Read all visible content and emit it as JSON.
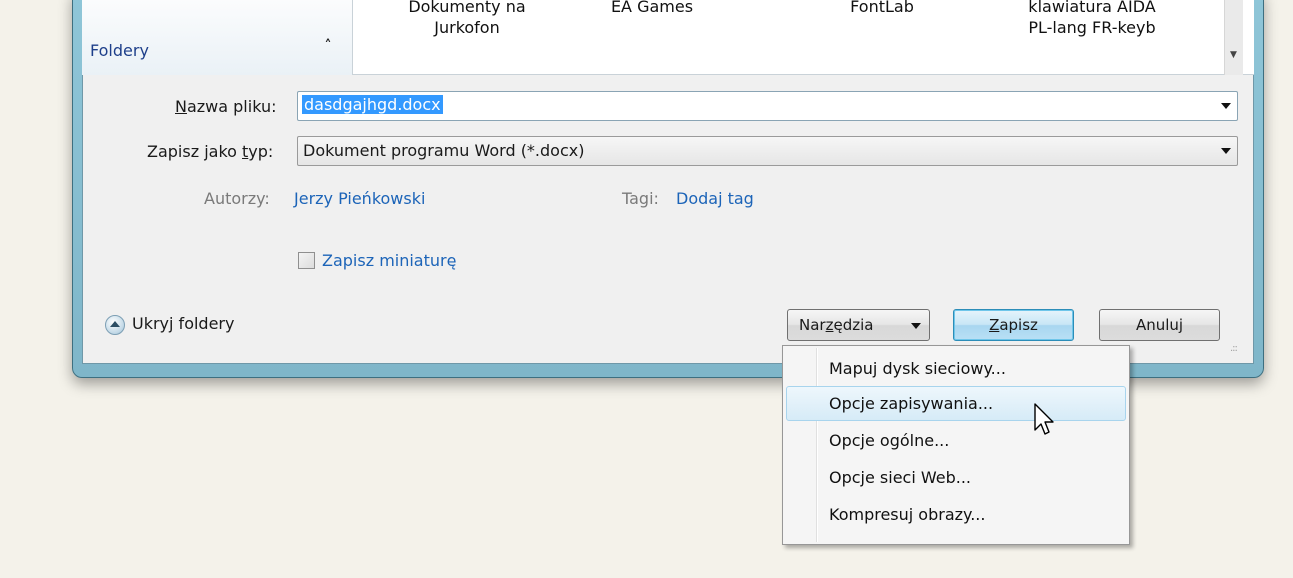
{
  "browser": {
    "folders_label": "Foldery",
    "files": [
      {
        "line1": "Dokumenty na",
        "line2": "Jurkofon"
      },
      {
        "line1": "EA Games",
        "line2": ""
      },
      {
        "line1": "FontLab",
        "line2": ""
      },
      {
        "line1": "klawiatura AIDA",
        "line2": "PL-lang  FR-keyb"
      }
    ]
  },
  "form": {
    "filename_label_accel": "N",
    "filename_label_rest": "azwa pliku:",
    "filename_value": "dasdgajhgd.docx",
    "type_label_pre": "Zapisz jako ",
    "type_label_accel": "t",
    "type_label_post": "yp:",
    "type_value": "Dokument programu Word (*.docx)",
    "authors_key": "Autorzy:",
    "authors_value": "Jerzy Pieńkowski",
    "tags_key": "Tagi:",
    "tags_value": "Dodaj tag",
    "thumbnail_label": "Zapisz miniaturę"
  },
  "footer": {
    "hide_folders": "Ukryj foldery",
    "tools_pre": "Nar",
    "tools_accel": "z",
    "tools_post": "ędzia",
    "save_accel": "Z",
    "save_rest": "apisz",
    "cancel": "Anuluj"
  },
  "menu": {
    "items": [
      "Mapuj dysk sieciowy...",
      "Opcje zapisywania...",
      "Opcje ogólne...",
      "Opcje sieci Web...",
      "Kompresuj obrazy..."
    ],
    "hovered_index": 1
  },
  "colors": {
    "link": "#1c64b8",
    "selection": "#3399ff",
    "frame": "#8fc6d8"
  }
}
